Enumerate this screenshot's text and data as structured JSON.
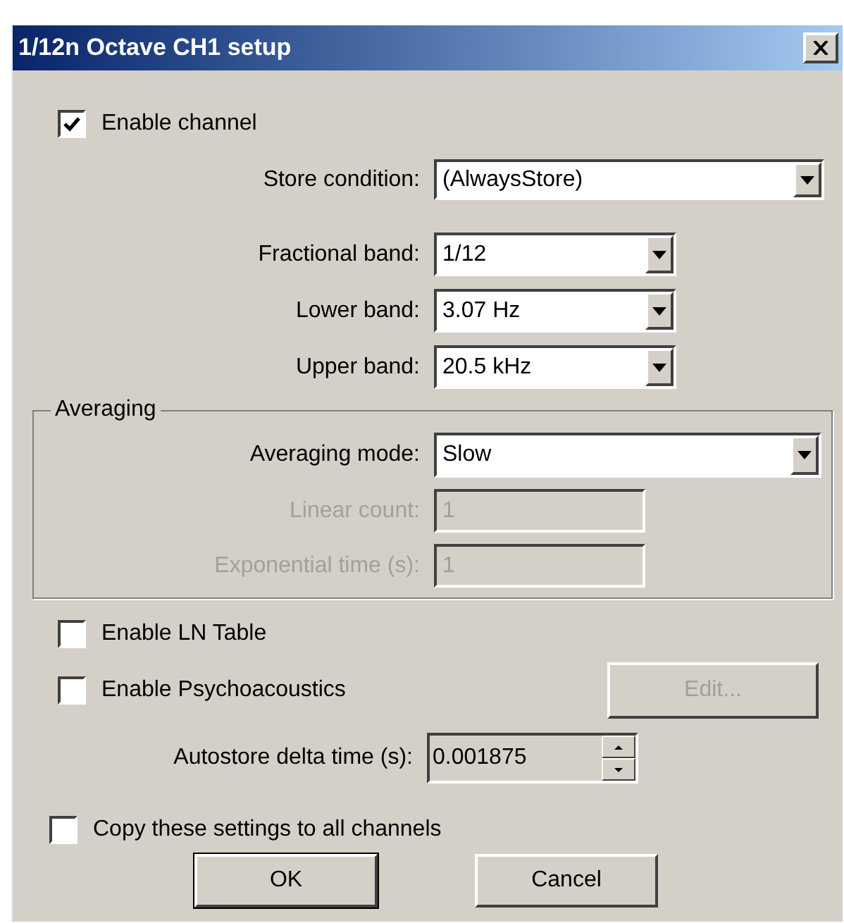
{
  "window": {
    "title": "1/12n Octave CH1 setup"
  },
  "enable_channel": {
    "label": "Enable channel",
    "checked": true
  },
  "store_condition": {
    "label": "Store condition:",
    "value": "(AlwaysStore)"
  },
  "band_fields": [
    {
      "label": "Fractional band:",
      "value": "1/12"
    },
    {
      "label": "Lower band:",
      "value": "3.07 Hz"
    },
    {
      "label": "Upper band:",
      "value": "20.5 kHz"
    }
  ],
  "averaging": {
    "title": "Averaging",
    "fields": [
      {
        "kind": "dropdown",
        "label": "Averaging mode:",
        "value": "Slow",
        "disabled": false
      },
      {
        "kind": "text",
        "label": "Linear count:",
        "value": "1",
        "disabled": true
      },
      {
        "kind": "text",
        "label": "Exponential time (s):",
        "value": "1",
        "disabled": true
      }
    ]
  },
  "ln_table": {
    "label": "Enable LN Table",
    "checked": false
  },
  "psychoacoustics": {
    "label": "Enable Psychoacoustics",
    "checked": false
  },
  "edit_button": {
    "label": "Edit...",
    "disabled": true
  },
  "autostore": {
    "label": "Autostore delta time (s):",
    "value": "0.001875"
  },
  "copy_settings": {
    "label": "Copy these settings to all channels",
    "checked": false
  },
  "buttons": [
    {
      "label": "OK",
      "default": true
    },
    {
      "label": "Cancel",
      "default": false
    }
  ]
}
